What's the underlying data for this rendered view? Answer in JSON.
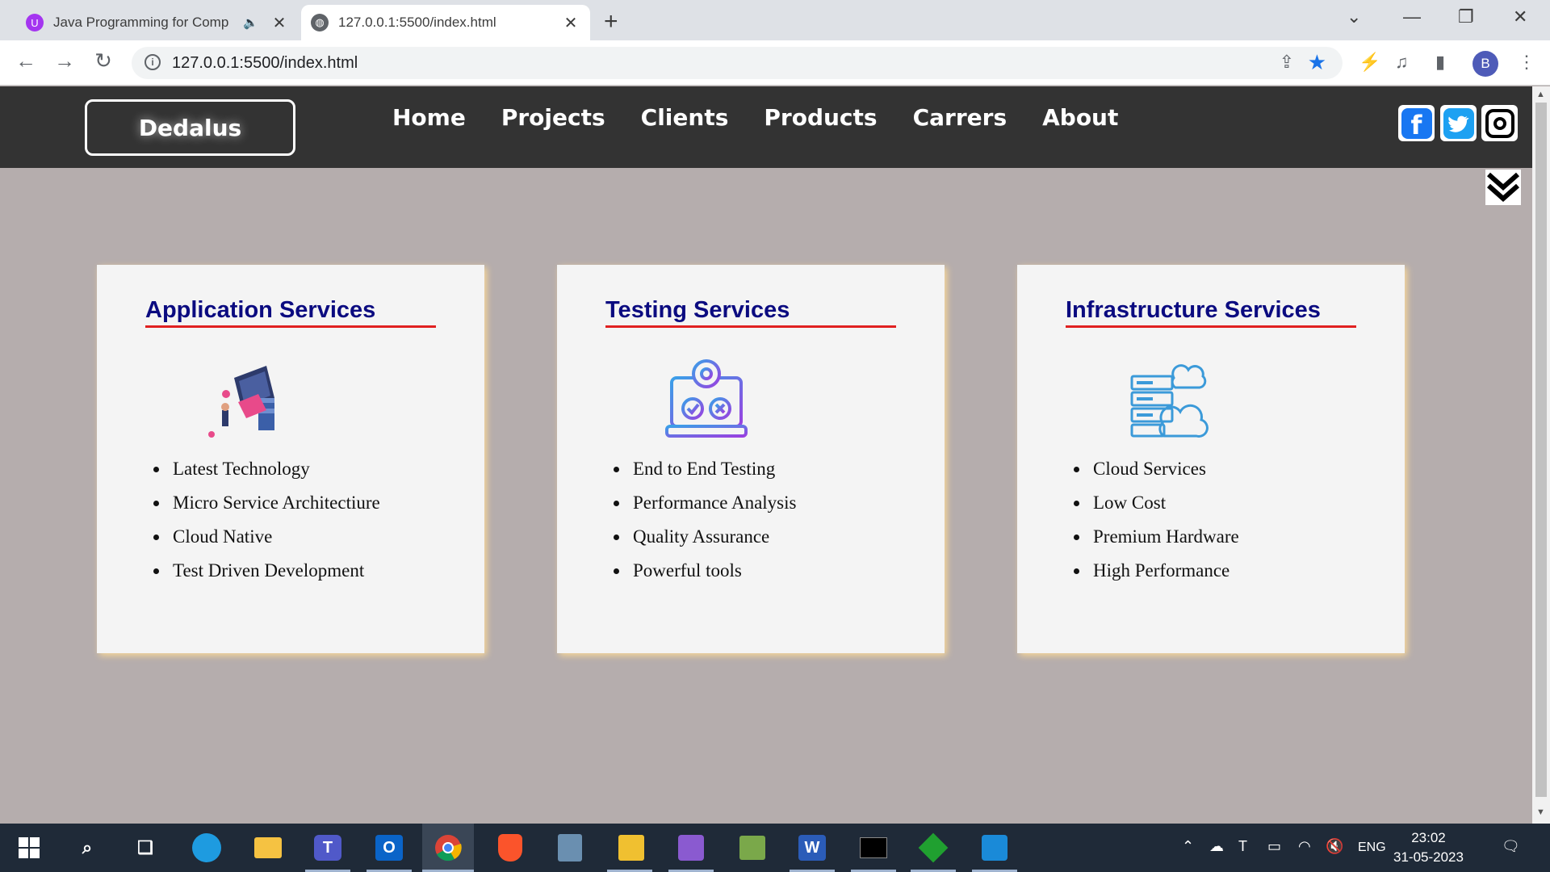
{
  "browser": {
    "tabs": [
      {
        "title": "Java Programming for Comp",
        "icon": "udemy-icon",
        "active": false
      },
      {
        "title": "127.0.0.1:5500/index.html",
        "icon": "globe-icon",
        "active": true
      }
    ],
    "url": "127.0.0.1:5500/index.html",
    "profile_initial": "B"
  },
  "site": {
    "logo": "Dedalus",
    "nav": [
      "Home",
      "Projects",
      "Clients",
      "Products",
      "Carrers",
      "About"
    ],
    "social": [
      "facebook-icon",
      "twitter-icon",
      "instagram-icon"
    ]
  },
  "cards": [
    {
      "title": "Application Services",
      "image": "application-illustration",
      "items": [
        "Latest Technology",
        "Micro Service Architectiure",
        "Cloud Native",
        "Test Driven Development"
      ]
    },
    {
      "title": "Testing Services",
      "image": "testing-illustration",
      "items": [
        "End to End Testing",
        "Performance Analysis",
        "Quality Assurance",
        "Powerful tools"
      ]
    },
    {
      "title": "Infrastructure Services",
      "image": "infrastructure-illustration",
      "items": [
        "Cloud Services",
        "Low Cost",
        "Premium Hardware",
        "High Performance"
      ]
    }
  ],
  "taskbar": {
    "apps": [
      "start-icon",
      "search-icon",
      "task-view-icon",
      "edge-icon",
      "file-explorer-icon",
      "teams-icon",
      "outlook-icon",
      "chrome-icon",
      "brave-icon",
      "app-icon",
      "app-icon",
      "visual-studio-icon",
      "app-icon",
      "word-icon",
      "terminal-icon",
      "app-icon",
      "vscode-icon"
    ],
    "language": "ENG",
    "time": "23:02",
    "date": "31-05-2023"
  },
  "colors": {
    "page_bg": "#b5adad",
    "header_bg": "#333333",
    "card_title": "#0b0b80",
    "card_underline": "#e02020"
  }
}
